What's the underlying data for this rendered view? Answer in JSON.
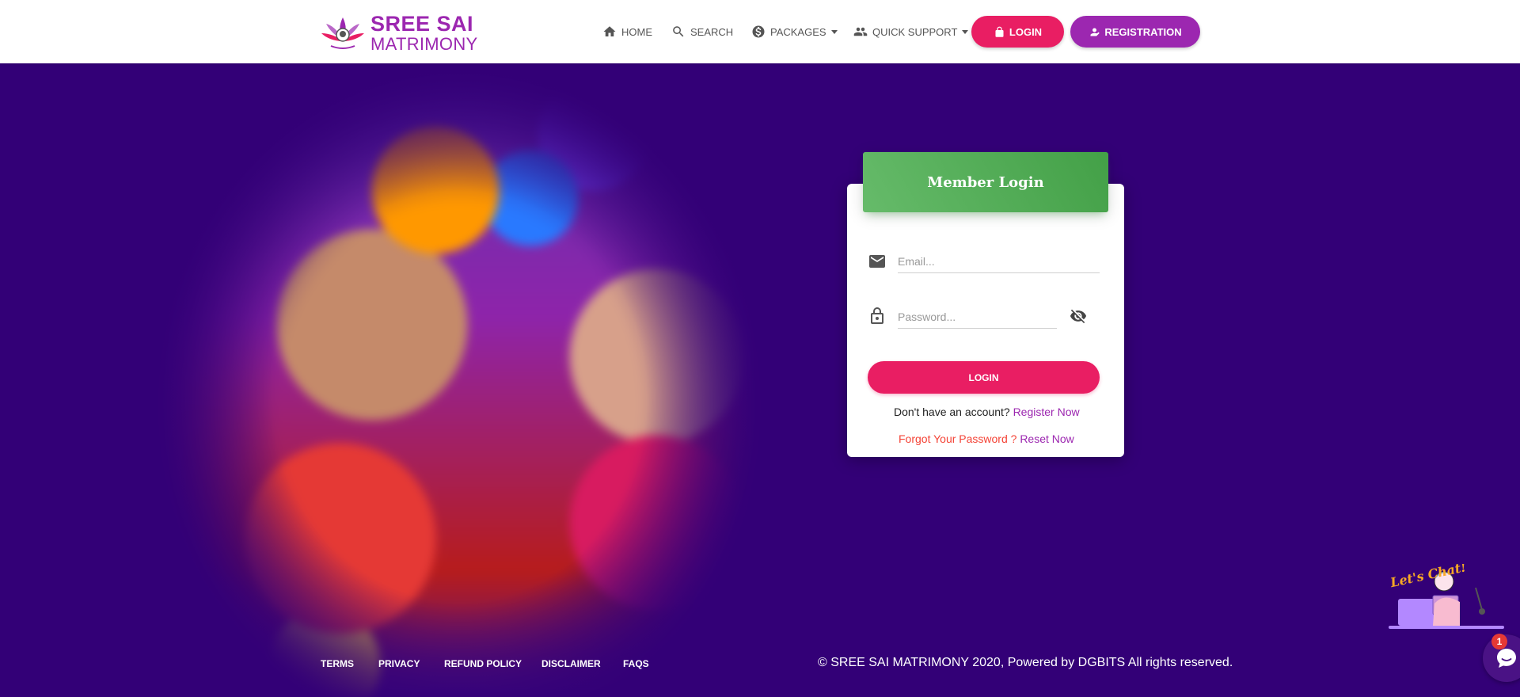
{
  "brand": {
    "line1": "SREE SAI",
    "line2": "MATRIMONY",
    "color": "#9c27b0"
  },
  "nav": {
    "items": [
      {
        "label": "HOME",
        "icon": "home-icon"
      },
      {
        "label": "SEARCH",
        "icon": "search-icon"
      },
      {
        "label": "PACKAGES",
        "icon": "dollar-icon"
      },
      {
        "label": "QUICK SUPPORT",
        "icon": "people-icon"
      }
    ],
    "login_label": "LOGIN",
    "registration_label": "REGISTRATION"
  },
  "login_card": {
    "title": "Member Login",
    "email_placeholder": "Email...",
    "password_placeholder": "Password...",
    "submit_label": "LOGIN",
    "no_account_text": "Don't have an account?",
    "register_link": "Register Now",
    "forgot_text": "Forgot Your Password ?",
    "reset_link": "Reset Now"
  },
  "footer": {
    "links": [
      "TERMS",
      "PRIVACY",
      "REFUND POLICY",
      "DISCLAIMER",
      "FAQS"
    ],
    "copyright": "© SREE SAI MATRIMONY 2020, Powered by DGBITS All rights reserved."
  },
  "chat": {
    "illustration_text": "Let's Chat!",
    "badge_count": "1"
  },
  "colors": {
    "background": "#330077",
    "primary_pink": "#e91e63",
    "primary_purple": "#9c27b0",
    "card_header_green": "#4caf50"
  }
}
